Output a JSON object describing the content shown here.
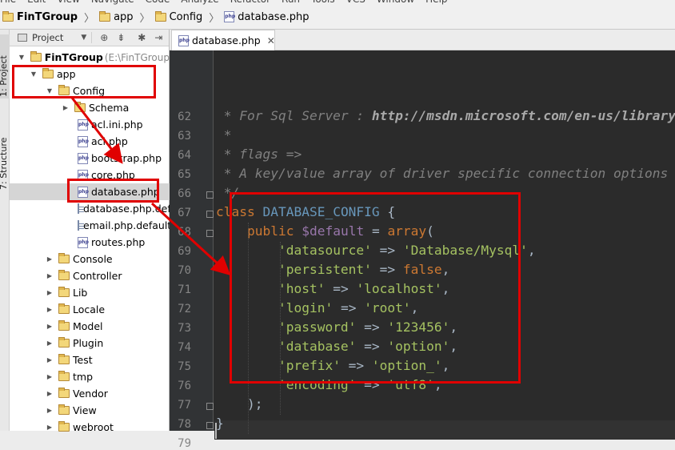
{
  "menu": [
    "File",
    "Edit",
    "View",
    "Navigate",
    "Code",
    "Analyze",
    "Refactor",
    "Run",
    "Tools",
    "VCS",
    "Window",
    "Help"
  ],
  "breadcrumb": [
    {
      "label": "FinTGroup",
      "icon": "folder-icon"
    },
    {
      "label": "app",
      "icon": "folder-icon"
    },
    {
      "label": "Config",
      "icon": "folder-icon"
    },
    {
      "label": "database.php",
      "icon": "php-file-icon"
    }
  ],
  "sidebar": {
    "project_tab": "1: Project",
    "structure_tab": "7: Structure"
  },
  "project_panel": {
    "view_label": "Project",
    "root": {
      "name": "FinTGroup",
      "path": "(E:\\FinTGroup"
    },
    "items": [
      {
        "label": "app",
        "icon": "folder-icon"
      },
      {
        "label": "Config",
        "icon": "folder-icon"
      },
      {
        "label": "Schema",
        "icon": "folder-icon"
      },
      {
        "label": "acl.ini.php",
        "icon": "php-file-icon"
      },
      {
        "label": "acl.php",
        "icon": "php-file-icon"
      },
      {
        "label": "bootstrap.php",
        "icon": "php-file-icon"
      },
      {
        "label": "core.php",
        "icon": "php-file-icon"
      },
      {
        "label": "database.php",
        "icon": "php-file-icon"
      },
      {
        "label": "database.php.default",
        "icon": "text-file-icon"
      },
      {
        "label": "email.php.default",
        "icon": "text-file-icon"
      },
      {
        "label": "routes.php",
        "icon": "php-file-icon"
      },
      {
        "label": "Console",
        "icon": "folder-icon"
      },
      {
        "label": "Controller",
        "icon": "folder-icon"
      },
      {
        "label": "Lib",
        "icon": "folder-icon"
      },
      {
        "label": "Locale",
        "icon": "folder-icon"
      },
      {
        "label": "Model",
        "icon": "folder-icon"
      },
      {
        "label": "Plugin",
        "icon": "folder-icon"
      },
      {
        "label": "Test",
        "icon": "folder-icon"
      },
      {
        "label": "tmp",
        "icon": "folder-icon"
      },
      {
        "label": "Vendor",
        "icon": "folder-icon"
      },
      {
        "label": "View",
        "icon": "folder-icon"
      },
      {
        "label": "webroot",
        "icon": "folder-icon"
      }
    ]
  },
  "editor": {
    "tab_label": "database.php",
    "lines": [
      {
        "n": "62",
        "parts": [
          [
            "c-com",
            " * For Sql Server : "
          ],
          [
            "c-url",
            "http://msdn.microsoft.com/en-us/library/"
          ]
        ]
      },
      {
        "n": "63",
        "parts": [
          [
            "c-com",
            " *"
          ]
        ]
      },
      {
        "n": "64",
        "parts": [
          [
            "c-com",
            " * flags =>"
          ]
        ]
      },
      {
        "n": "65",
        "parts": [
          [
            "c-com",
            " * A key/value array of driver specific connection options"
          ]
        ]
      },
      {
        "n": "66",
        "parts": [
          [
            "c-com",
            " */"
          ]
        ]
      },
      {
        "n": "67",
        "parts": [
          [
            "c-kw",
            "class "
          ],
          [
            "c-cls",
            "DATABASE_CONFIG "
          ],
          [
            "c-txt",
            "{"
          ]
        ]
      },
      {
        "n": "68",
        "parts": [
          [
            "c-txt",
            "    "
          ],
          [
            "c-kw",
            "public "
          ],
          [
            "c-var",
            "$default "
          ],
          [
            "c-txt",
            "= "
          ],
          [
            "c-kw",
            "array"
          ],
          [
            "c-txt",
            "("
          ]
        ]
      },
      {
        "n": "69",
        "parts": [
          [
            "c-txt",
            "        "
          ],
          [
            "c-str",
            "'datasource'"
          ],
          [
            "c-txt",
            " => "
          ],
          [
            "c-str",
            "'Database/Mysql'"
          ],
          [
            "c-txt",
            ","
          ]
        ]
      },
      {
        "n": "70",
        "parts": [
          [
            "c-txt",
            "        "
          ],
          [
            "c-str",
            "'persistent'"
          ],
          [
            "c-txt",
            " => "
          ],
          [
            "c-kw",
            "false"
          ],
          [
            "c-txt",
            ","
          ]
        ]
      },
      {
        "n": "71",
        "parts": [
          [
            "c-txt",
            "        "
          ],
          [
            "c-str",
            "'host'"
          ],
          [
            "c-txt",
            " => "
          ],
          [
            "c-str",
            "'localhost'"
          ],
          [
            "c-txt",
            ","
          ]
        ]
      },
      {
        "n": "72",
        "parts": [
          [
            "c-txt",
            "        "
          ],
          [
            "c-str",
            "'login'"
          ],
          [
            "c-txt",
            " => "
          ],
          [
            "c-str",
            "'root'"
          ],
          [
            "c-txt",
            ","
          ]
        ]
      },
      {
        "n": "73",
        "parts": [
          [
            "c-txt",
            "        "
          ],
          [
            "c-str",
            "'password'"
          ],
          [
            "c-txt",
            " => "
          ],
          [
            "c-str",
            "'123456'"
          ],
          [
            "c-txt",
            ","
          ]
        ]
      },
      {
        "n": "74",
        "parts": [
          [
            "c-txt",
            "        "
          ],
          [
            "c-str",
            "'database'"
          ],
          [
            "c-txt",
            " => "
          ],
          [
            "c-str",
            "'option'"
          ],
          [
            "c-txt",
            ","
          ]
        ]
      },
      {
        "n": "75",
        "parts": [
          [
            "c-txt",
            "        "
          ],
          [
            "c-str",
            "'prefix'"
          ],
          [
            "c-txt",
            " => "
          ],
          [
            "c-str",
            "'option_'"
          ],
          [
            "c-txt",
            ","
          ]
        ]
      },
      {
        "n": "76",
        "parts": [
          [
            "c-txt",
            "        "
          ],
          [
            "c-str",
            "'encoding'"
          ],
          [
            "c-txt",
            " => "
          ],
          [
            "c-str",
            "'utf8'"
          ],
          [
            "c-txt",
            ","
          ]
        ]
      },
      {
        "n": "77",
        "parts": [
          [
            "c-txt",
            "    );"
          ]
        ]
      },
      {
        "n": "78",
        "parts": [
          [
            "c-txt",
            "}"
          ]
        ]
      },
      {
        "n": "79",
        "parts": []
      }
    ]
  },
  "colors": {
    "annotation": "#e00000",
    "editor_bg": "#2b2b2b",
    "keyword": "#cc7832",
    "string": "#a5c261",
    "variable": "#9876aa",
    "class_name": "#6897bb",
    "comment": "#808080"
  }
}
